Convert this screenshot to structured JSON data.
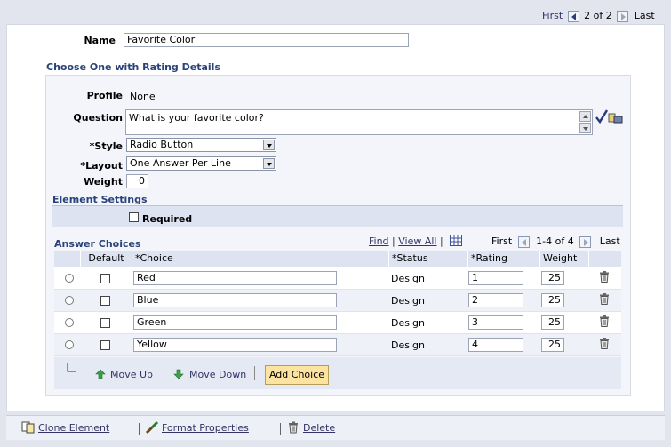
{
  "pager_top": {
    "first": "First",
    "count": "2 of 2",
    "last": "Last"
  },
  "name": {
    "label": "Name",
    "value": "Favorite Color"
  },
  "section_title": "Choose One with Rating Details",
  "profile": {
    "label": "Profile",
    "value": "None"
  },
  "question": {
    "label": "Question",
    "value": "What is your favorite color?"
  },
  "style": {
    "label": "*Style",
    "value": "Radio Button"
  },
  "layout": {
    "label": "*Layout",
    "value": "One Answer Per Line"
  },
  "weight": {
    "label": "Weight",
    "value": "0"
  },
  "element_settings": {
    "title": "Element Settings",
    "required_label": "Required"
  },
  "answer_choices": {
    "title": "Answer Choices",
    "find": "Find",
    "view_all": "View All",
    "first": "First",
    "count": "1-4 of 4",
    "last": "Last",
    "headers": {
      "default": "Default",
      "choice": "*Choice",
      "status": "*Status",
      "rating": "*Rating",
      "weight": "Weight"
    },
    "rows": [
      {
        "choice": "Red",
        "status": "Design",
        "rating": "1",
        "weight": "25"
      },
      {
        "choice": "Blue",
        "status": "Design",
        "rating": "2",
        "weight": "25"
      },
      {
        "choice": "Green",
        "status": "Design",
        "rating": "3",
        "weight": "25"
      },
      {
        "choice": "Yellow",
        "status": "Design",
        "rating": "4",
        "weight": "25"
      }
    ],
    "move_up": "Move Up",
    "move_down": "Move Down",
    "add_choice": "Add Choice"
  },
  "footer": {
    "clone": "Clone Element",
    "format": "Format Properties",
    "delete": "Delete"
  },
  "colors": {
    "accent": "#29427a",
    "header_bg": "#dde3f0",
    "button_bg": "#fce4a0"
  }
}
